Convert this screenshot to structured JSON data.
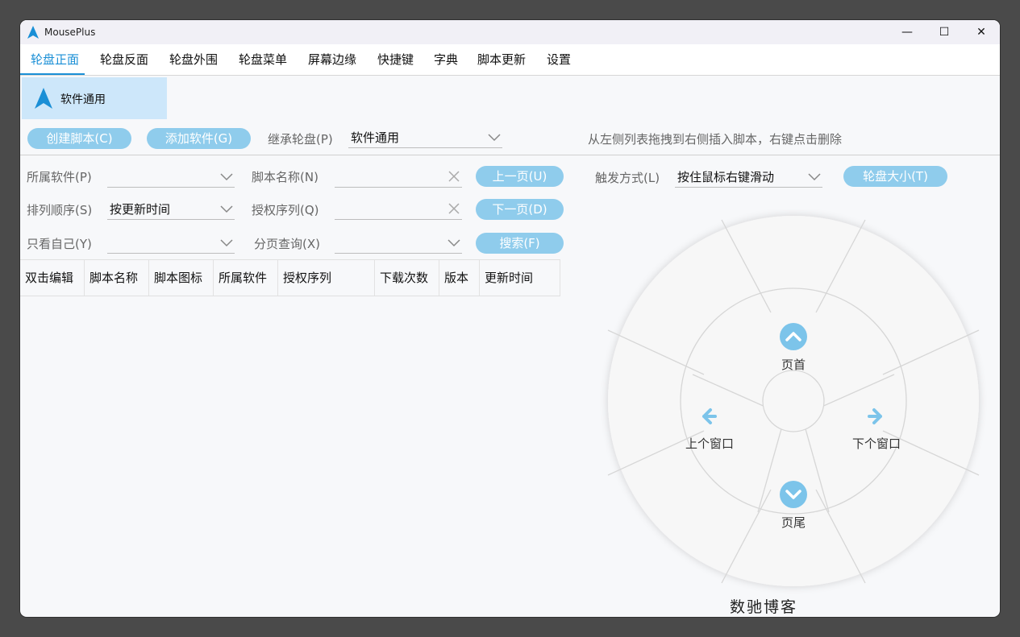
{
  "window": {
    "title": "MousePlus",
    "minimize_glyph": "—",
    "maximize_glyph": "☐",
    "close_glyph": "✕"
  },
  "menu": {
    "items": [
      "轮盘正面",
      "轮盘反面",
      "轮盘外围",
      "轮盘菜单",
      "屏幕边缘",
      "快捷键",
      "字典",
      "脚本更新",
      "设置"
    ],
    "active_index": 0
  },
  "sidebar": {
    "tile_label": "软件通用"
  },
  "toolbar": {
    "create_script": "创建脚本(C)",
    "add_software": "添加软件(G)",
    "inherit_label": "继承轮盘(P)",
    "inherit_value": "软件通用",
    "hint": "从左侧列表拖拽到右侧插入脚本，右键点击删除"
  },
  "filters": {
    "software_label": "所属软件(P)",
    "software_value": "",
    "script_name_label": "脚本名称(N)",
    "script_name_value": "",
    "prev_page": "上一页(U)",
    "sort_label": "排列顺序(S)",
    "sort_value": "按更新时间",
    "license_label": "授权序列(Q)",
    "license_value": "",
    "next_page": "下一页(D)",
    "mine_label": "只看自己(Y)",
    "mine_value": "",
    "page_label": "分页查询(X)",
    "page_value": "",
    "search": "搜索(F)",
    "clear_icon": "✕"
  },
  "trigger": {
    "label": "触发方式(L)",
    "value": "按住鼠标右键滑动",
    "wheel_size": "轮盘大小(T)"
  },
  "table": {
    "columns": [
      "双击编辑",
      "脚本名称",
      "脚本图标",
      "所属软件",
      "授权序列",
      "下载次数",
      "版本",
      "更新时间"
    ],
    "rows": []
  },
  "wheel": {
    "top_label": "页首",
    "left_label": "上个窗口",
    "right_label": "下个窗口",
    "bottom_label": "页尾"
  },
  "watermark": "数驰博客",
  "colors": {
    "accent": "#1a8fd6",
    "pill": "#8fccec",
    "tile": "#cde7fa",
    "icon": "#7cc4ea"
  }
}
